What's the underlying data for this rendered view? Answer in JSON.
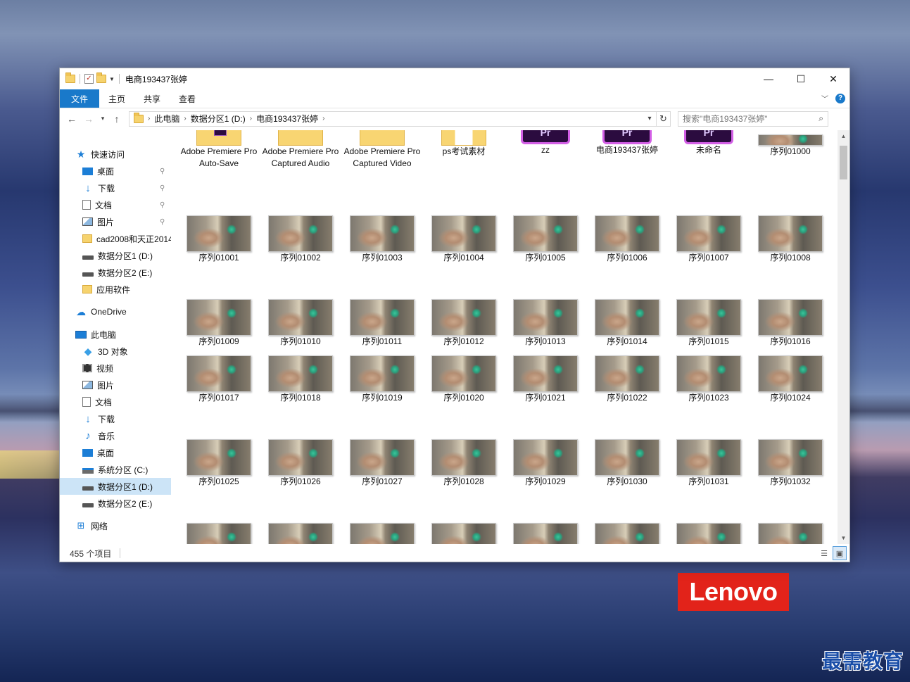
{
  "window": {
    "title": "电商193437张婷"
  },
  "ribbon": {
    "tabs": [
      "文件",
      "主页",
      "共享",
      "查看"
    ]
  },
  "address": {
    "crumbs": [
      "此电脑",
      "数据分区1 (D:)",
      "电商193437张婷"
    ],
    "search_placeholder": "搜索\"电商193437张婷\""
  },
  "sidebar": {
    "items": [
      {
        "label": "快速访问",
        "icon": "star-icon",
        "level": 0,
        "pinned": false,
        "group": false
      },
      {
        "label": "桌面",
        "icon": "desktop-icon",
        "level": 1,
        "pinned": true
      },
      {
        "label": "下载",
        "icon": "download-icon",
        "level": 1,
        "pinned": true
      },
      {
        "label": "文档",
        "icon": "document-icon",
        "level": 1,
        "pinned": true
      },
      {
        "label": "图片",
        "icon": "picture-icon",
        "level": 1,
        "pinned": true
      },
      {
        "label": "cad2008和天正2014",
        "icon": "folder-icon",
        "level": 1,
        "pinned": false
      },
      {
        "label": "数据分区1 (D:)",
        "icon": "drive-icon",
        "level": 1,
        "pinned": false
      },
      {
        "label": "数据分区2 (E:)",
        "icon": "drive-icon",
        "level": 1,
        "pinned": false
      },
      {
        "label": "应用软件",
        "icon": "folder-icon",
        "level": 1,
        "pinned": false
      },
      {
        "label": "OneDrive",
        "icon": "onedrive-icon",
        "level": 0,
        "group": true
      },
      {
        "label": "此电脑",
        "icon": "this-pc-icon",
        "level": 0,
        "group": true
      },
      {
        "label": "3D 对象",
        "icon": "3d-objects-icon",
        "level": 1
      },
      {
        "label": "视频",
        "icon": "video-icon",
        "level": 1
      },
      {
        "label": "图片",
        "icon": "picture-icon",
        "level": 1
      },
      {
        "label": "文档",
        "icon": "document-icon",
        "level": 1
      },
      {
        "label": "下载",
        "icon": "download-icon",
        "level": 1
      },
      {
        "label": "音乐",
        "icon": "music-icon",
        "level": 1
      },
      {
        "label": "桌面",
        "icon": "desktop-icon",
        "level": 1
      },
      {
        "label": "系统分区 (C:)",
        "icon": "system-drive-icon",
        "level": 1
      },
      {
        "label": "数据分区1 (D:)",
        "icon": "drive-icon",
        "level": 1,
        "selected": true
      },
      {
        "label": "数据分区2 (E:)",
        "icon": "drive-icon",
        "level": 1
      },
      {
        "label": "网络",
        "icon": "network-icon",
        "level": 0,
        "group": true
      }
    ]
  },
  "files": {
    "top_row": [
      {
        "name": "Adobe Premiere Pro Auto-Save",
        "kind": "premiere-folder"
      },
      {
        "name": "Adobe Premiere Pro Captured Audio",
        "kind": "folder"
      },
      {
        "name": "Adobe Premiere Pro Captured Video",
        "kind": "folder"
      },
      {
        "name": "ps考试素材",
        "kind": "doc-folder"
      },
      {
        "name": "zz",
        "kind": "prproj"
      },
      {
        "name": "电商193437张婷",
        "kind": "prproj"
      },
      {
        "name": "未命名",
        "kind": "prproj"
      },
      {
        "name": "序列01000",
        "kind": "image"
      }
    ],
    "prproj_badge": "Pr",
    "sequence_prefix": "序列",
    "sequence_start": 1001,
    "sequence_visible_rows": 4,
    "sequence_columns": 8
  },
  "status": {
    "item_count": "455 个项目"
  },
  "colors": {
    "accent": "#1979ca",
    "selection": "#cce4f7",
    "lenovo": "#e2231a"
  },
  "desktop": {
    "brand": "Lenovo",
    "watermark": "最需教育"
  }
}
